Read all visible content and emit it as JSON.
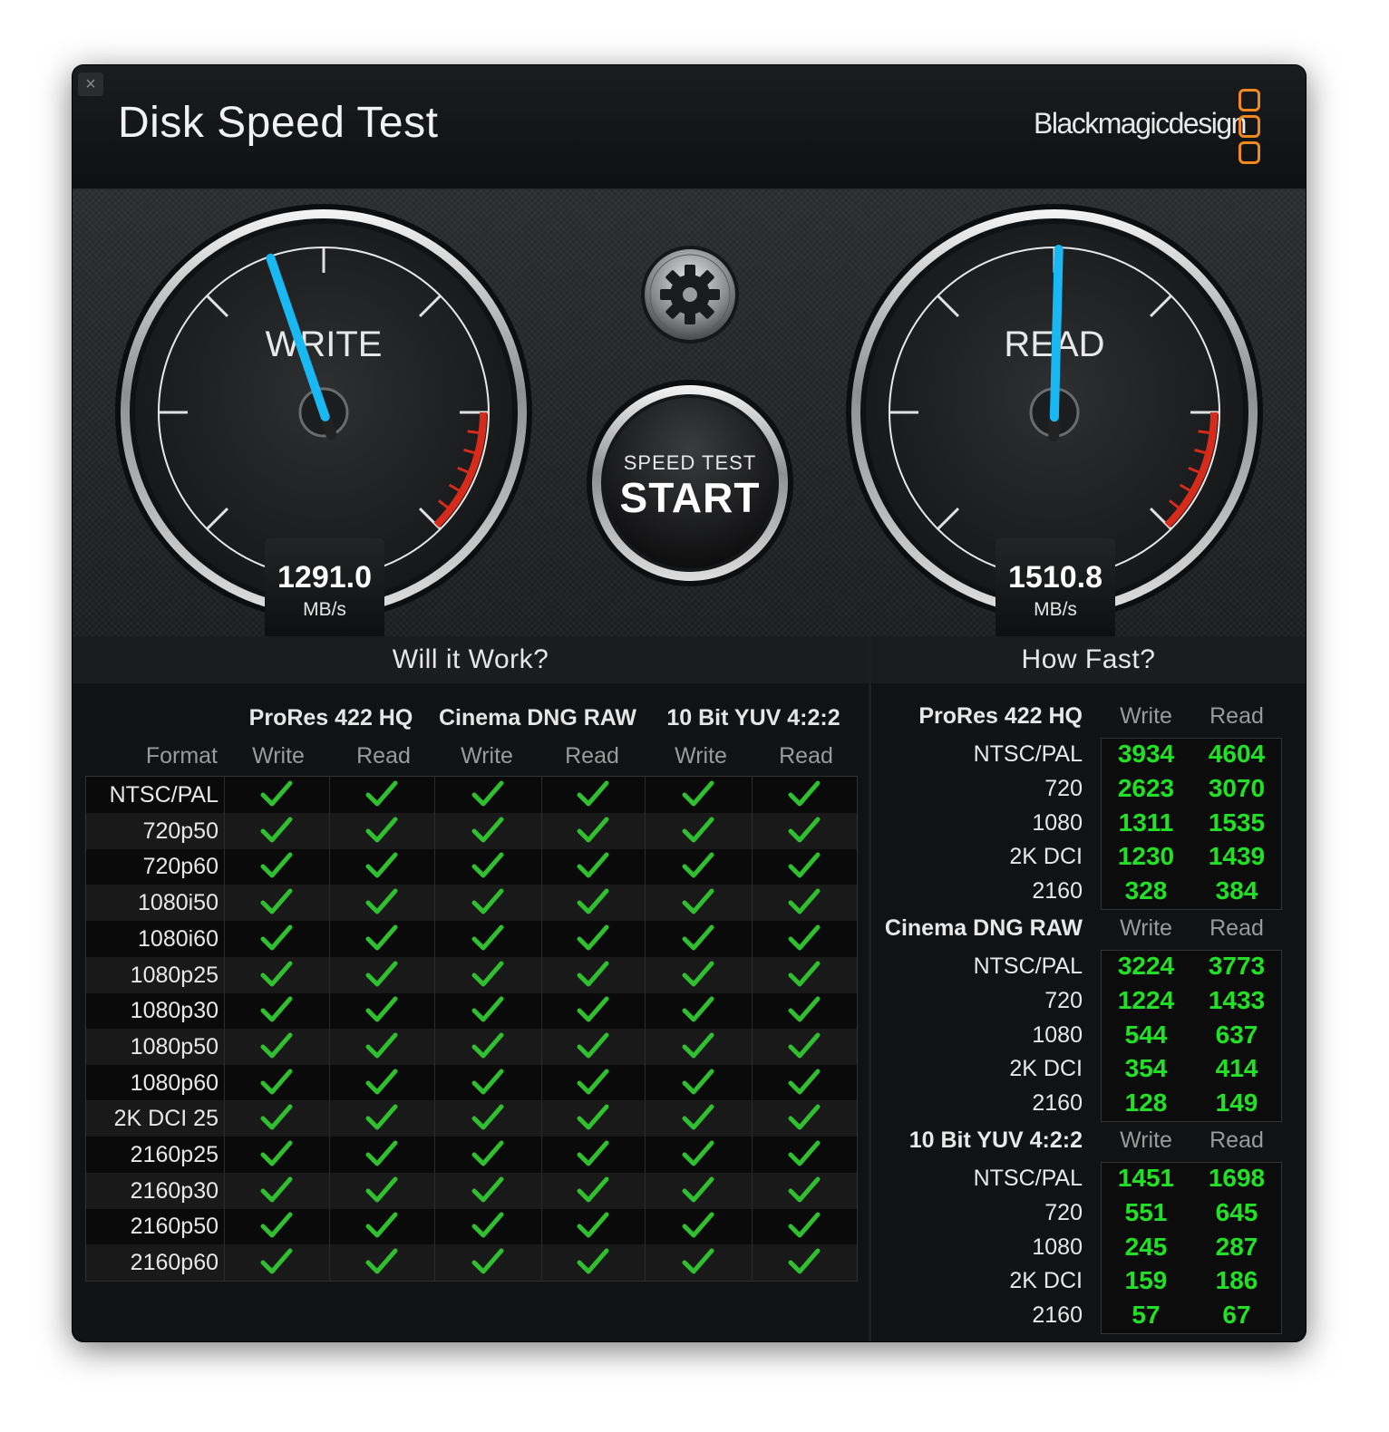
{
  "window": {
    "close_icon": "×",
    "title": "Disk Speed Test",
    "brand": "Blackmagicdesign"
  },
  "gauges": {
    "write": {
      "label": "WRITE",
      "value": "1291.0",
      "unit": "MB/s"
    },
    "read": {
      "label": "READ",
      "value": "1510.8",
      "unit": "MB/s"
    }
  },
  "start_button": {
    "small": "SPEED TEST",
    "big": "START"
  },
  "will_it_work": {
    "heading": "Will it Work?",
    "format_header": "Format",
    "codecs": [
      "ProRes 422 HQ",
      "Cinema DNG RAW",
      "10 Bit YUV 4:2:2"
    ],
    "col_headers": [
      "Write",
      "Read",
      "Write",
      "Read",
      "Write",
      "Read"
    ],
    "formats": [
      "NTSC/PAL",
      "720p50",
      "720p60",
      "1080i50",
      "1080i60",
      "1080p25",
      "1080p30",
      "1080p50",
      "1080p60",
      "2K DCI 25",
      "2160p25",
      "2160p30",
      "2160p50",
      "2160p60"
    ],
    "all_pass": true
  },
  "how_fast": {
    "heading": "How Fast?",
    "groups": [
      {
        "codec": "ProRes 422 HQ",
        "write_label": "Write",
        "read_label": "Read",
        "rows": [
          {
            "format": "NTSC/PAL",
            "write": "3934",
            "read": "4604"
          },
          {
            "format": "720",
            "write": "2623",
            "read": "3070"
          },
          {
            "format": "1080",
            "write": "1311",
            "read": "1535"
          },
          {
            "format": "2K DCI",
            "write": "1230",
            "read": "1439"
          },
          {
            "format": "2160",
            "write": "328",
            "read": "384"
          }
        ]
      },
      {
        "codec": "Cinema DNG RAW",
        "write_label": "Write",
        "read_label": "Read",
        "rows": [
          {
            "format": "NTSC/PAL",
            "write": "3224",
            "read": "3773"
          },
          {
            "format": "720",
            "write": "1224",
            "read": "1433"
          },
          {
            "format": "1080",
            "write": "544",
            "read": "637"
          },
          {
            "format": "2K DCI",
            "write": "354",
            "read": "414"
          },
          {
            "format": "2160",
            "write": "128",
            "read": "149"
          }
        ]
      },
      {
        "codec": "10 Bit YUV 4:2:2",
        "write_label": "Write",
        "read_label": "Read",
        "rows": [
          {
            "format": "NTSC/PAL",
            "write": "1451",
            "read": "1698"
          },
          {
            "format": "720",
            "write": "551",
            "read": "645"
          },
          {
            "format": "1080",
            "write": "245",
            "read": "287"
          },
          {
            "format": "2K DCI",
            "write": "159",
            "read": "186"
          },
          {
            "format": "2160",
            "write": "57",
            "read": "67"
          }
        ]
      }
    ]
  },
  "colors": {
    "accent_blue": "#1ab8f2",
    "value_green": "#22e026",
    "check_green": "#2fbf2f",
    "brand_orange": "#f08a1e",
    "redline": "#d62b1a"
  },
  "icons": {
    "gear": "gear-icon",
    "close": "close-icon",
    "check": "checkmark-icon",
    "logo": "blackmagic-logo-icon"
  }
}
